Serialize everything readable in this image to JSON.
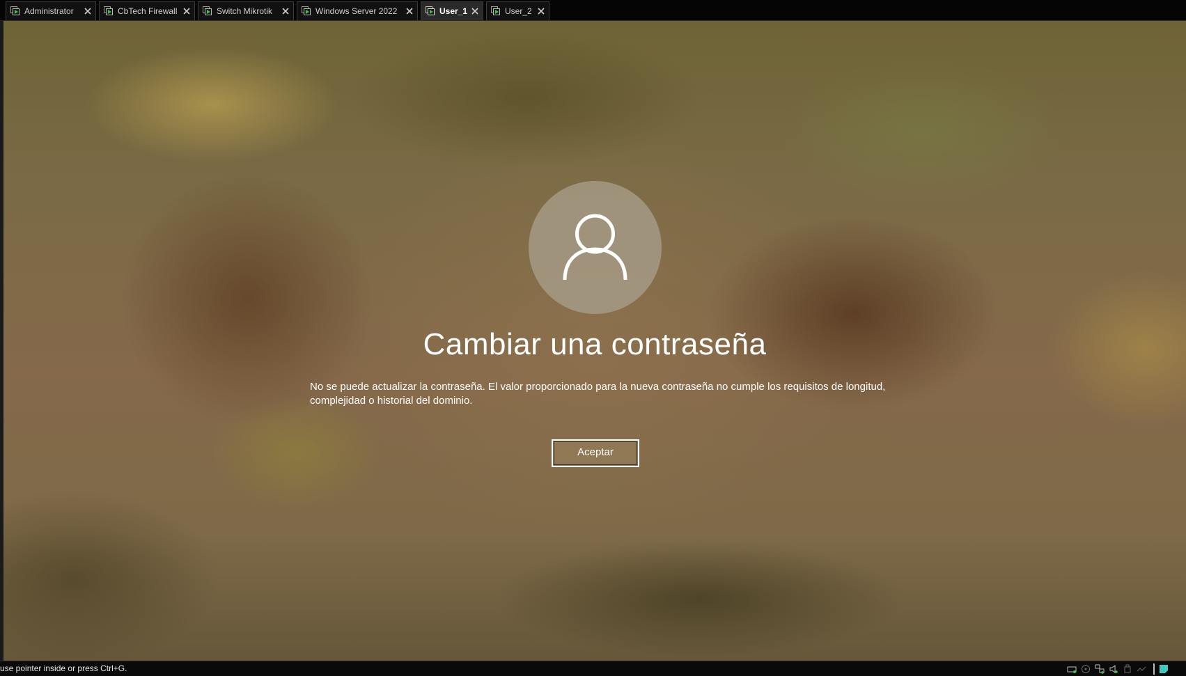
{
  "tabs": [
    {
      "label": "Administrator",
      "active": false
    },
    {
      "label": "CbTech Firewall",
      "active": false
    },
    {
      "label": "Switch Mikrotik",
      "active": false
    },
    {
      "label": "Windows Server 2022",
      "active": false
    },
    {
      "label": "User_1",
      "active": true
    },
    {
      "label": "User_2",
      "active": false
    }
  ],
  "dialog": {
    "title": "Cambiar una contraseña",
    "message_line1": "No se puede actualizar la contraseña. El valor proporcionado para la nueva contraseña no cumple los requisitos de longitud,",
    "message_line2": "complejidad o historial del dominio.",
    "accept_label": "Aceptar"
  },
  "statusbar": {
    "hint": "use pointer inside or press Ctrl+G.",
    "tray_icons": [
      "hard-disk-icon",
      "cd-drive-icon",
      "network-icon",
      "sound-icon",
      "usb-icon",
      "display-icon",
      "notification-icon"
    ]
  },
  "colors": {
    "accent_green": "#3fc43f",
    "tray_accent": "#40c8c0",
    "tab_active_bg": "#2a2a2a"
  }
}
